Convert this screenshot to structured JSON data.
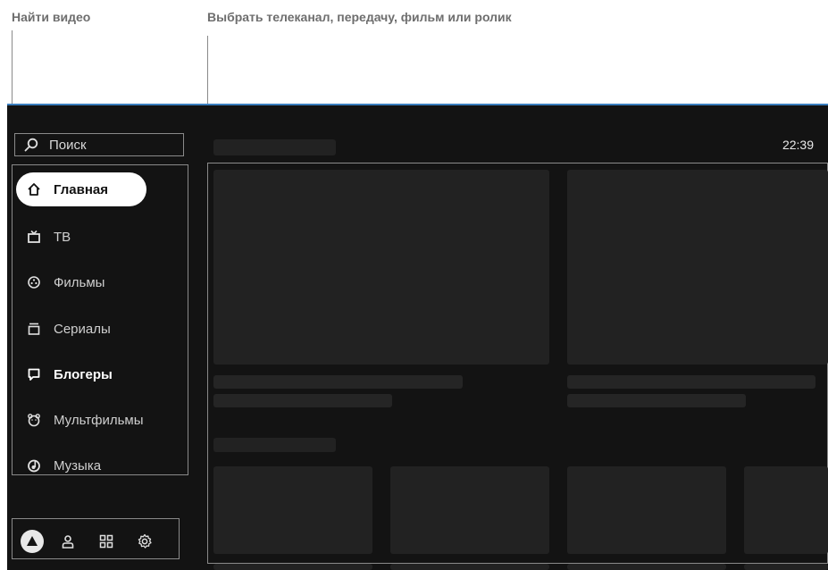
{
  "callouts": {
    "search_label": "Найти видео",
    "content_label": "Выбрать телеканал, передачу, фильм или ролик"
  },
  "search": {
    "label": "Поиск",
    "icon": "search-icon"
  },
  "clock": "22:39",
  "nav": {
    "items": [
      {
        "label": "Главная",
        "icon": "home-icon",
        "active": true
      },
      {
        "label": "ТВ",
        "icon": "tv-icon"
      },
      {
        "label": "Фильмы",
        "icon": "film-reel-icon"
      },
      {
        "label": "Сериалы",
        "icon": "series-icon"
      },
      {
        "label": "Блогеры",
        "icon": "chat-icon"
      },
      {
        "label": "Мультфильмы",
        "icon": "bear-icon"
      },
      {
        "label": "Музыка",
        "icon": "music-icon"
      }
    ]
  },
  "bottom_bar": {
    "icons": [
      "alice-icon",
      "profile-icon",
      "apps-grid-icon",
      "settings-icon"
    ]
  },
  "colors": {
    "background": "#131313",
    "placeholder": "#222222",
    "accent_border": "#3a7ebf",
    "active_item": "#ffffff"
  }
}
